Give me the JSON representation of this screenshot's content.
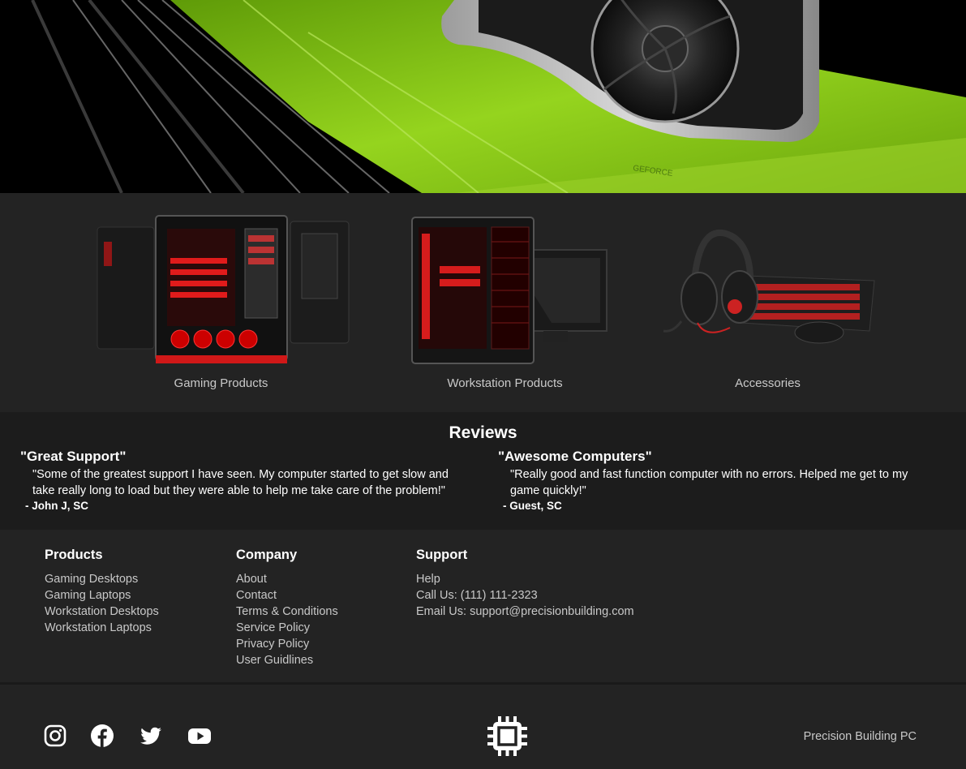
{
  "hero": {
    "alt": "graphics-card-banner"
  },
  "categories": [
    {
      "label": "Gaming Products"
    },
    {
      "label": "Workstation Products"
    },
    {
      "label": "Accessories"
    }
  ],
  "reviews": {
    "heading": "Reviews",
    "items": [
      {
        "title": "\"Great Support\"",
        "body": "\"Some of the greatest support I have seen. My computer started to get slow and take really long to load but they were able to help me take care of the problem!\"",
        "author": "- John J, SC"
      },
      {
        "title": "\"Awesome Computers\"",
        "body": "\"Really good and fast function computer with no errors. Helped me get to my game quickly!\"",
        "author": "- Guest, SC"
      }
    ]
  },
  "footer": {
    "products": {
      "heading": "Products",
      "links": [
        "Gaming Desktops",
        "Gaming Laptops",
        "Workstation Desktops",
        "Workstation Laptops"
      ]
    },
    "company": {
      "heading": "Company",
      "links": [
        "About",
        "Contact",
        "Terms & Conditions",
        "Service Policy",
        "Privacy Policy",
        "User Guidlines"
      ]
    },
    "support": {
      "heading": "Support",
      "links": [
        "Help",
        "Call Us: (111) 111-2323",
        "Email Us: support@precisionbuilding.com"
      ]
    }
  },
  "bottom": {
    "social_icons": [
      "instagram-icon",
      "facebook-icon",
      "twitter-icon",
      "youtube-icon"
    ],
    "logo_icon": "cpu-chip-icon",
    "brand": "Precision Building PC"
  },
  "colors": {
    "accent_green": "#8ccf1c",
    "bg_dark": "#232323",
    "bg_reviews": "#1c1c1c",
    "text_light": "#c8c8c8"
  }
}
